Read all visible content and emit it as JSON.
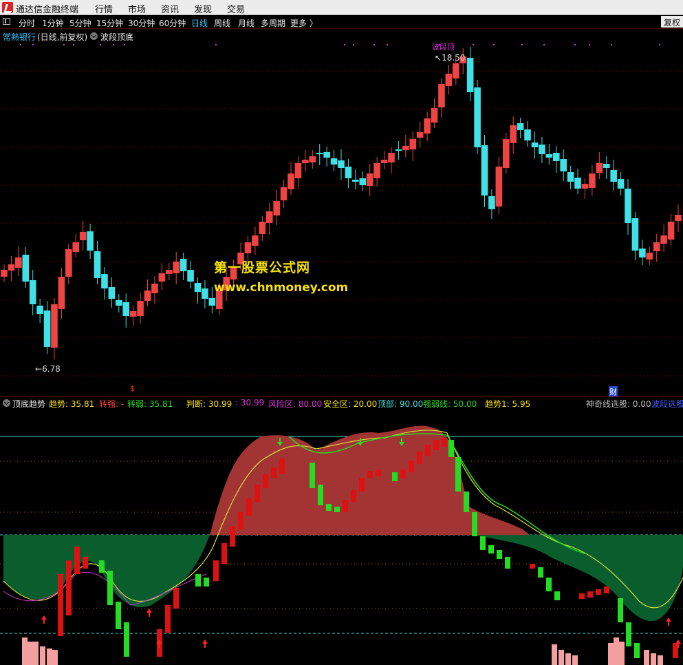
{
  "app": {
    "title": "通达信金融终端"
  },
  "menu": [
    "行情",
    "市场",
    "资讯",
    "发现",
    "交易"
  ],
  "periods": [
    "分时",
    "1分钟",
    "5分钟",
    "15分钟",
    "30分钟",
    "60分钟",
    "日线",
    "周线",
    "月线",
    "多周期",
    "更多 〉"
  ],
  "active_period": "日线",
  "restore_label": "复权",
  "stock": {
    "name": "常熟银行",
    "mode": "(日线,前复权)",
    "formula": "波段顶底"
  },
  "price_labels": {
    "high": "18.50",
    "low": "6.78",
    "peak_tag": "波段顶"
  },
  "watermark": {
    "line1": "第一股票公式网",
    "line2": "www.chnmoney.com"
  },
  "markers": {
    "s_marker": "$",
    "cai_marker": "财"
  },
  "indicator": {
    "name": "顶底趋势",
    "items": [
      {
        "text": "趋势: 35.81",
        "color": "#f5e10a"
      },
      {
        "text": "转强: -",
        "color": "#ff4444"
      },
      {
        "text": "转弱: 35.81",
        "color": "#22dd22"
      },
      {
        "text": "判断: 30.99",
        "color": "#f5e10a"
      },
      {
        "text": ": 30.99",
        "color": "#dd33dd"
      },
      {
        "text": "风险区: 80.00",
        "color": "#dd33dd"
      },
      {
        "text": "安全区: 20.00",
        "color": "#f5e10a"
      },
      {
        "text": "顶部: 90.00",
        "color": "#44dddd"
      },
      {
        "text": "强弱线: 50.00",
        "color": "#22dd22"
      },
      {
        "text": "趋势1: 5.95",
        "color": "#f5e10a"
      },
      {
        "text": "神奇线选股: 0.00",
        "color": "#bbbbbb"
      },
      {
        "text": "波段选股",
        "color": "#3a5bff"
      }
    ]
  },
  "colors": {
    "up": "#ef4444",
    "down": "#3fe0e6",
    "risk_fill": "#a33434",
    "safe_fill": "#0a5e2e"
  }
}
